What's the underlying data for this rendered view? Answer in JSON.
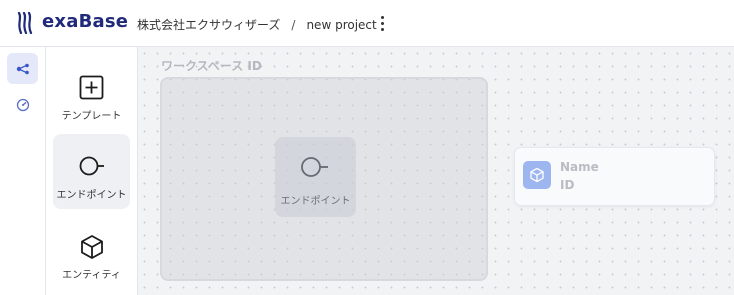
{
  "app": {
    "name": "exaBase",
    "logo_icon": "exabase-logo-icon",
    "brand_color": "#1f2a7a"
  },
  "breadcrumb": {
    "organization": "株式会社エクサウィザーズ",
    "separator": "/",
    "project": "new project"
  },
  "header": {
    "more_icon": "more-vertical-icon"
  },
  "rail": {
    "items": [
      {
        "icon": "flow-diagram-icon",
        "active": true
      },
      {
        "icon": "gauge-icon",
        "active": false
      }
    ],
    "active_color": "#e4e8f8",
    "accent_color": "#3a57c9"
  },
  "palette": {
    "items": [
      {
        "label": "テンプレート",
        "icon": "plus-square-icon"
      },
      {
        "label": "エンドポイント",
        "icon": "endpoint-icon",
        "selected": true
      },
      {
        "label": "エンティティ",
        "icon": "cube-icon"
      }
    ]
  },
  "canvas": {
    "workspace": {
      "title": "ワークスペース ID",
      "endpoint_label": "エンドポイント"
    },
    "entity": {
      "name": "Name",
      "id": "ID",
      "icon": "cube-icon",
      "icon_color": "#9db6ef"
    }
  }
}
